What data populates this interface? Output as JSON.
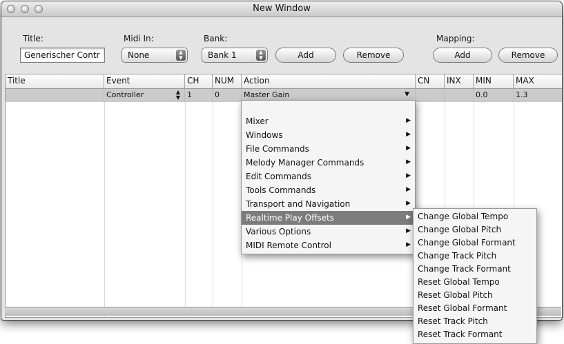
{
  "window": {
    "title": "New Window"
  },
  "form": {
    "title_label": "Title:",
    "title_value": "Generischer Contr",
    "midi_in_label": "Midi In:",
    "midi_in_value": "None",
    "bank_label": "Bank:",
    "bank_value": "Bank 1",
    "bank_add": "Add",
    "bank_remove": "Remove",
    "mapping_label": "Mapping:",
    "mapping_add": "Add",
    "mapping_remove": "Remove"
  },
  "table": {
    "columns": [
      "Title",
      "Event",
      "CH",
      "NUM",
      "Action",
      "CN",
      "INX",
      "MIN",
      "MAX"
    ],
    "rows": [
      {
        "title": "",
        "event": "Controller",
        "ch": "1",
        "num": "0",
        "action": "Master Gain",
        "cn": "",
        "inx": "",
        "min": "0.0",
        "max": "1.3"
      }
    ]
  },
  "action_menu": {
    "items": [
      {
        "label": "Mixer"
      },
      {
        "label": "Windows"
      },
      {
        "label": "File Commands"
      },
      {
        "label": "Melody Manager Commands"
      },
      {
        "label": "Edit Commands"
      },
      {
        "label": "Tools Commands"
      },
      {
        "label": "Transport and Navigation"
      },
      {
        "label": "Realtime Play Offsets"
      },
      {
        "label": "Various Options"
      },
      {
        "label": "MIDI Remote Control"
      }
    ],
    "highlighted": "Realtime Play Offsets"
  },
  "submenu": {
    "items": [
      {
        "label": "Change Global Tempo"
      },
      {
        "label": "Change Global Pitch"
      },
      {
        "label": "Change Global Formant"
      },
      {
        "label": "Change Track Pitch"
      },
      {
        "label": "Change Track Formant"
      },
      {
        "label": "Reset Global Tempo"
      },
      {
        "label": "Reset Global Pitch"
      },
      {
        "label": "Reset Global Formant"
      },
      {
        "label": "Reset Track Pitch"
      },
      {
        "label": "Reset Track Formant"
      }
    ]
  },
  "icons": {
    "submenu_arrow": "triangle-right",
    "dropdown_arrow": "triangle-down",
    "stepper": "up-down-arrows"
  },
  "colors": {
    "highlight": "#7c7c7c",
    "row_selected": "#cbcbcb"
  }
}
